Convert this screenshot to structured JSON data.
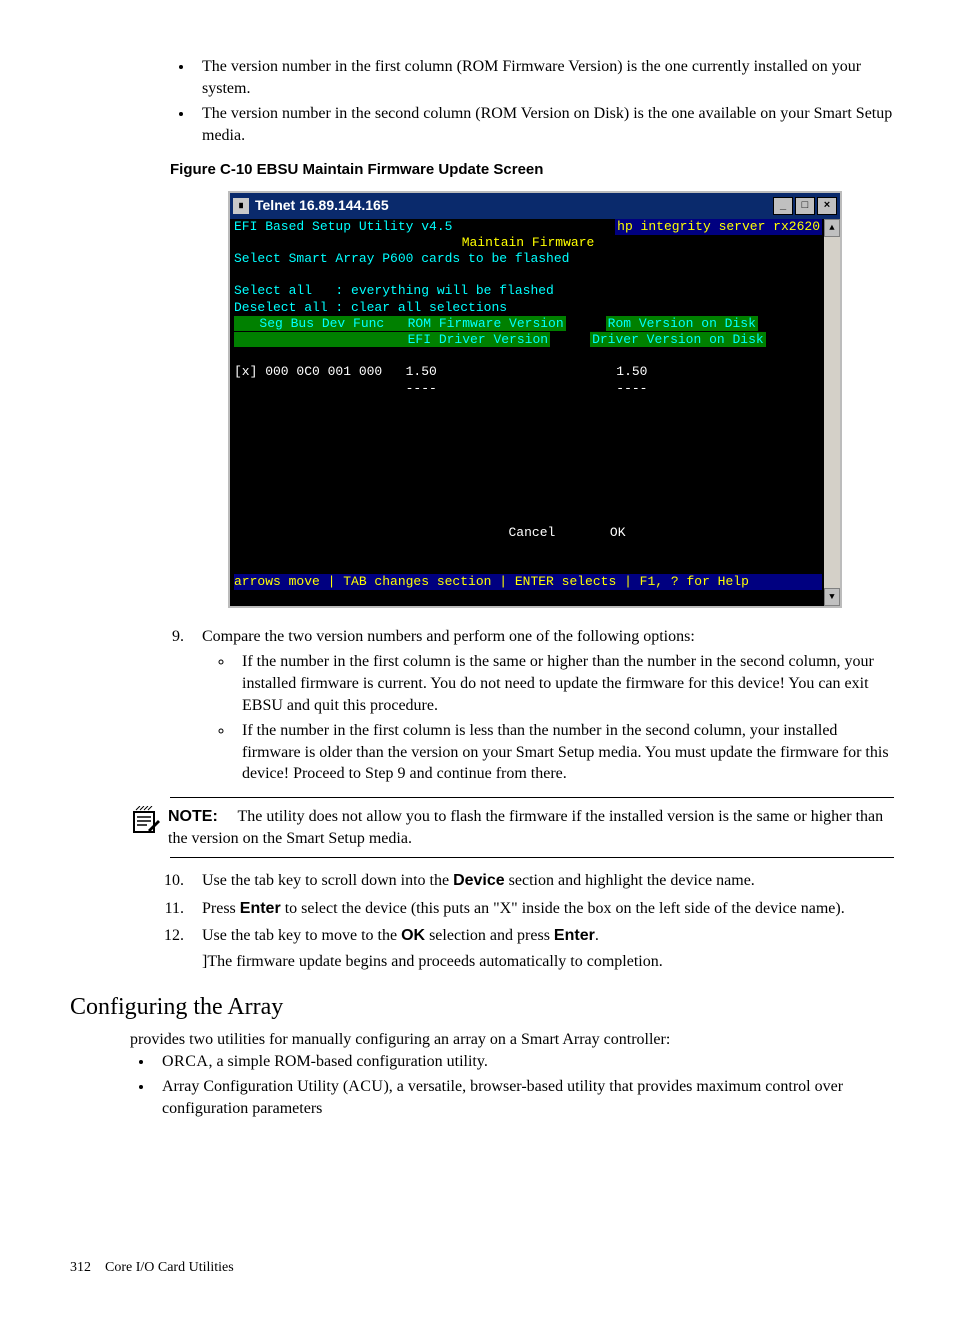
{
  "intro_bullets": [
    "The version number in the first column (ROM Firmware Version) is the one currently installed on your system.",
    "The version number in the second column (ROM Version on Disk) is the one available on your Smart Setup media."
  ],
  "figure_caption": "Figure C-10   EBSU Maintain Firmware Update Screen",
  "telnet": {
    "title": "Telnet 16.89.144.165",
    "btn_min": "_",
    "btn_max": "□",
    "btn_close": "×",
    "line_util": "EFI Based Setup Utility v4.5",
    "line_server": "hp integrity server rx2620",
    "line_maintain": "Maintain Firmware",
    "line_select_cards": "Select Smart Array P600 cards to be flashed",
    "line_sel_all": "Select all   : everything will be flashed",
    "line_desel_all": "Deselect all : clear all selections",
    "hdr_left": "   Seg Bus Dev Func   ROM Firmware Version",
    "hdr_right": "Rom Version on Disk",
    "hdr2_left": "                      EFI Driver Version",
    "hdr2_right": "Driver Version on Disk",
    "data_row": "[x] 000 0C0 001 000   1.50                       1.50",
    "dash_row": "                      ----                       ----",
    "btn_cancel": "Cancel",
    "btn_ok": "OK",
    "help_bar": "arrows move | TAB changes section | ENTER selects | F1, ? for Help"
  },
  "step9": {
    "num": "9",
    "lead": "Compare the two version numbers and perform one of the following options:",
    "bullets": [
      "If the number in the first column is the same or higher than the number in the second column, your installed firmware is current. You do not need to update the firmware for this device! You can exit EBSU and quit this procedure.",
      "If the number in the first column is less than the number in the second column, your installed firmware is older than the version on your Smart Setup media. You must update the firmware for this device! Proceed to Step 9 and continue from there."
    ]
  },
  "note": {
    "label": "NOTE:",
    "text": "The utility does not allow you to flash the firmware if the installed version is the same or higher than the version on the Smart Setup media."
  },
  "steps_later": {
    "s10": {
      "pre": "Use the tab key to scroll down into the ",
      "bold": "Device",
      "post": " section and highlight the device name."
    },
    "s11": {
      "pre": "Press ",
      "bold": "Enter",
      "post": " to select the device (this puts an \"X\" inside the box on the left side of the device name)."
    },
    "s12": {
      "pre": "Use the tab key to move to the ",
      "bold": "OK",
      "mid": " selection and press ",
      "bold2": "Enter",
      "post": ".",
      "tail": "]The firmware update begins and proceeds automatically to completion."
    }
  },
  "array": {
    "heading": "Configuring the Array",
    "lead": "provides two utilities for manually configuring an array on a Smart Array controller:",
    "bullets": [
      {
        "sc": "ORCA",
        "rest": ", a simple ROM-based configuration utility."
      },
      {
        "plain": "Array Configuration Utility (",
        "sc": "ACU",
        "rest": "), a versatile, browser-based utility that provides maximum control over configuration parameters"
      }
    ]
  },
  "footer": {
    "page": "312",
    "title": "Core I/O Card Utilities"
  }
}
